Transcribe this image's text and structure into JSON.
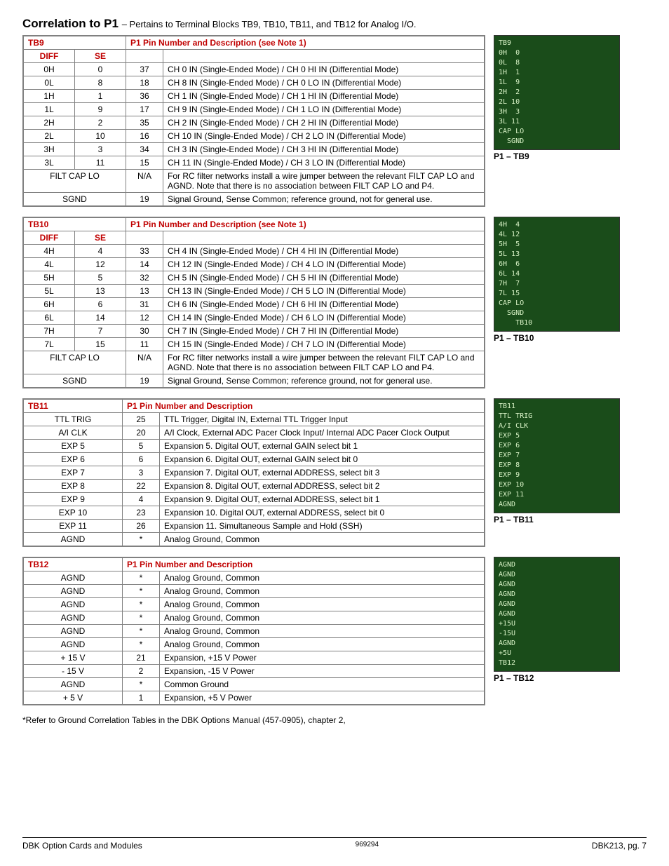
{
  "title": "Correlation to P1",
  "subtitle": "– Pertains to Terminal Blocks TB9, TB10, TB11, and TB12 for Analog I/O.",
  "tb9": {
    "name": "TB9",
    "p1head": "P1 Pin Number and Description  (see Note 1)",
    "subhead": [
      "DIFF",
      "SE"
    ],
    "rows": [
      [
        "0H",
        "0",
        "37",
        "CH 0 IN (Single-Ended Mode) /  CH 0 HI IN (Differential Mode)"
      ],
      [
        "0L",
        "8",
        "18",
        "CH 8 IN (Single-Ended Mode) /  CH 0 LO IN (Differential Mode)"
      ],
      [
        "1H",
        "1",
        "36",
        "CH 1 IN (Single-Ended Mode) /  CH 1 HI IN (Differential Mode)"
      ],
      [
        "1L",
        "9",
        "17",
        "CH 9 IN (Single-Ended Mode) /  CH 1 LO IN (Differential Mode)"
      ],
      [
        "2H",
        "2",
        "35",
        "CH 2 IN (Single-Ended Mode) /  CH 2 HI IN (Differential Mode)"
      ],
      [
        "2L",
        "10",
        "16",
        "CH 10 IN (Single-Ended Mode) /  CH 2 LO IN (Differential Mode)"
      ],
      [
        "3H",
        "3",
        "34",
        "CH 3 IN (Single-Ended Mode) /  CH 3 HI IN (Differential Mode)"
      ],
      [
        "3L",
        "11",
        "15",
        "CH 11 IN (Single-Ended Mode) /  CH 3 LO IN (Differential Mode)"
      ]
    ],
    "filt": [
      "FILT CAP LO",
      "N/A",
      "For RC filter networks install a wire jumper between the relevant FILT CAP LO and AGND.  Note that there is no association between FILT CAP LO and P4."
    ],
    "sgnd": [
      "SGND",
      "19",
      "Signal Ground, Sense Common; reference ground, not for general use."
    ],
    "caption": "P1 – TB9",
    "img": "TB9\n0H  0\n0L  8\n1H  1\n1L  9\n2H  2\n2L 10\n3H  3\n3L 11\nCAP LO\n  SGND"
  },
  "tb10": {
    "name": "TB10",
    "p1head": "P1 Pin Number and Description (see Note 1)",
    "subhead": [
      "DIFF",
      "SE"
    ],
    "rows": [
      [
        "4H",
        "4",
        "33",
        "CH 4 IN (Single-Ended Mode) /  CH 4 HI IN (Differential Mode)"
      ],
      [
        "4L",
        "12",
        "14",
        "CH 12 IN (Single-Ended Mode) /  CH 4 LO IN (Differential Mode)"
      ],
      [
        "5H",
        "5",
        "32",
        "CH 5 IN (Single-Ended Mode) /  CH 5 HI IN (Differential Mode)"
      ],
      [
        "5L",
        "13",
        "13",
        "CH 13 IN (Single-Ended Mode) /  CH 5 LO IN (Differential Mode)"
      ],
      [
        "6H",
        "6",
        "31",
        "CH 6 IN (Single-Ended Mode) /  CH 6 HI IN (Differential Mode)"
      ],
      [
        "6L",
        "14",
        "12",
        "CH 14 IN (Single-Ended Mode) /  CH 6 LO IN (Differential Mode)"
      ],
      [
        "7H",
        "7",
        "30",
        "CH 7 IN (Single-Ended Mode) /  CH 7 HI IN (Differential Mode)"
      ],
      [
        "7L",
        "15",
        "11",
        "CH 15 IN (Single-Ended Mode) /  CH 7 LO IN (Differential Mode)"
      ]
    ],
    "filt": [
      "FILT CAP LO",
      "N/A",
      "For RC filter networks install a wire jumper between the relevant FILT CAP LO and AGND.  Note that there is no association between FILT CAP LO and P4."
    ],
    "sgnd": [
      "SGND",
      "19",
      "Signal Ground, Sense Common; reference ground, not for general use."
    ],
    "caption": "P1 – TB10",
    "img": "4H  4\n4L 12\n5H  5\n5L 13\n6H  6\n6L 14\n7H  7\n7L 15\nCAP LO\n  SGND\n    TB10"
  },
  "tb11": {
    "name": "TB11",
    "p1head": "P1 Pin Number and Description",
    "rows": [
      [
        "TTL TRIG",
        "25",
        "TTL Trigger, Digital IN, External TTL Trigger Input"
      ],
      [
        "A/I CLK",
        "20",
        "A/I Clock, External ADC Pacer Clock Input/ Internal ADC Pacer Clock Output"
      ],
      [
        "EXP 5",
        "5",
        "Expansion 5.  Digital OUT, external GAIN select bit 1"
      ],
      [
        "EXP 6",
        "6",
        "Expansion 6.  Digital OUT, external GAIN select bit 0"
      ],
      [
        "EXP 7",
        "3",
        "Expansion 7.  Digital OUT, external ADDRESS, select bit 3"
      ],
      [
        "EXP 8",
        "22",
        "Expansion 8.  Digital OUT, external ADDRESS, select bit 2"
      ],
      [
        "EXP 9",
        "4",
        "Expansion 9.  Digital OUT, external ADDRESS, select bit 1"
      ],
      [
        "EXP 10",
        "23",
        "Expansion 10.  Digital OUT, external ADDRESS, select bit 0"
      ],
      [
        "EXP 11",
        "26",
        "Expansion 11.  Simultaneous Sample and Hold (SSH)"
      ],
      [
        "AGND",
        "*",
        "Analog Ground, Common"
      ]
    ],
    "caption": "P1 – TB11",
    "img": "TB11\nTTL TRIG\nA/I CLK\nEXP 5\nEXP 6\nEXP 7\nEXP 8\nEXP 9\nEXP 10\nEXP 11\nAGND"
  },
  "tb12": {
    "name": "TB12",
    "p1head": "P1 Pin Number and Description",
    "rows": [
      [
        "AGND",
        "*",
        "Analog Ground, Common"
      ],
      [
        "AGND",
        "*",
        "Analog Ground, Common"
      ],
      [
        "AGND",
        "*",
        "Analog Ground, Common"
      ],
      [
        "AGND",
        "*",
        "Analog Ground, Common"
      ],
      [
        "AGND",
        "*",
        "Analog Ground, Common"
      ],
      [
        "AGND",
        "*",
        "Analog Ground, Common"
      ],
      [
        "+ 15 V",
        "21",
        "Expansion, +15 V Power"
      ],
      [
        "- 15 V",
        "2",
        "Expansion, -15 V Power"
      ],
      [
        "AGND",
        "*",
        "Common Ground"
      ],
      [
        "+ 5 V",
        "1",
        "Expansion, +5 V Power"
      ]
    ],
    "caption": "P1 – TB12",
    "img": "AGND\nAGND\nAGND\nAGND\nAGND\nAGND\n+15U\n-15U\nAGND\n+5U\nTB12"
  },
  "footnote": "*Refer to Ground Correlation Tables in the DBK Options Manual (457-0905), chapter 2,",
  "footer": {
    "left": "DBK Option Cards and Modules",
    "center": "969294",
    "right": "DBK213, pg.  7"
  }
}
